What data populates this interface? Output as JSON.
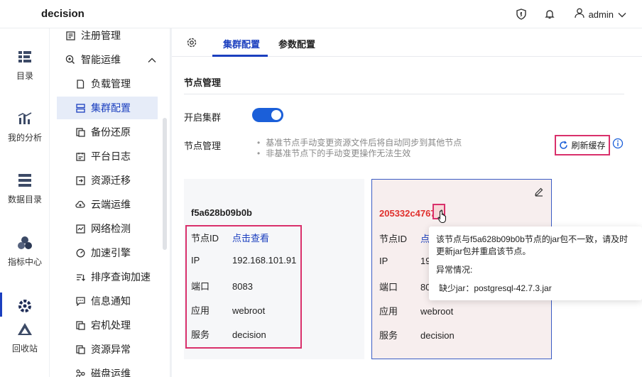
{
  "header": {
    "brand": "decision",
    "user": "admin"
  },
  "rail": {
    "items": [
      {
        "label": "目录",
        "icon": "catalog-icon"
      },
      {
        "label": "我的分析",
        "icon": "analysis-icon"
      },
      {
        "label": "数据目录",
        "icon": "data-catalog-icon"
      },
      {
        "label": "指标中心",
        "icon": "metrics-icon"
      },
      {
        "label": "",
        "icon": "settings-icon"
      },
      {
        "label": "回收站",
        "icon": "recycle-icon"
      }
    ]
  },
  "nav": {
    "items": [
      {
        "label": "注册管理",
        "icon": "register-icon"
      },
      {
        "label": "智能运维",
        "icon": "ops-icon"
      },
      {
        "label": "负载管理",
        "icon": "load-icon"
      },
      {
        "label": "集群配置",
        "icon": "cluster-icon"
      },
      {
        "label": "备份还原",
        "icon": "backup-icon"
      },
      {
        "label": "平台日志",
        "icon": "log-icon"
      },
      {
        "label": "资源迁移",
        "icon": "migrate-icon"
      },
      {
        "label": "云端运维",
        "icon": "cloud-icon"
      },
      {
        "label": "网络检测",
        "icon": "network-icon"
      },
      {
        "label": "加速引擎",
        "icon": "engine-icon"
      },
      {
        "label": "排序查询加速",
        "icon": "sort-icon"
      },
      {
        "label": "信息通知",
        "icon": "notify-icon"
      },
      {
        "label": "宕机处理",
        "icon": "crash-icon"
      },
      {
        "label": "资源异常",
        "icon": "anomaly-icon"
      },
      {
        "label": "磁盘运维",
        "icon": "disk-icon"
      }
    ]
  },
  "tabs": {
    "cluster": "集群配置",
    "params": "参数配置"
  },
  "section": {
    "title": "节点管理",
    "enable_cluster_label": "开启集群",
    "enable_cluster_on": true,
    "node_mgmt_label": "节点管理",
    "notes": [
      "基准节点手动变更资源文件后将自动同步到其他节点",
      "非基准节点下的手动变更操作无法生效"
    ],
    "refresh_label": "刷新缓存"
  },
  "cards": [
    {
      "title": "f5a628b09b0b",
      "rows": [
        {
          "key": "节点ID",
          "value": "点击查看"
        },
        {
          "key": "IP",
          "value": "192.168.101.91"
        },
        {
          "key": "端口",
          "value": "8083"
        },
        {
          "key": "应用",
          "value": "webroot"
        },
        {
          "key": "服务",
          "value": "decision"
        }
      ]
    },
    {
      "title": "205332c4767f",
      "rows": [
        {
          "key": "节点ID",
          "value": "点"
        },
        {
          "key": "IP",
          "value": "19"
        },
        {
          "key": "端口",
          "value": "80"
        },
        {
          "key": "应用",
          "value": "webroot"
        },
        {
          "key": "服务",
          "value": "decision"
        }
      ]
    }
  ],
  "tooltip": {
    "message": "该节点与f5a628b09b0b节点的jar包不一致，请及时更新jar包并重启该节点。",
    "heading": "异常情况:",
    "detail": "缺少jar：postgresql-42.7.3.jar"
  },
  "colors": {
    "accent": "#1b3fbf",
    "highlight": "#d9306b",
    "warning_text": "#e0302c"
  }
}
